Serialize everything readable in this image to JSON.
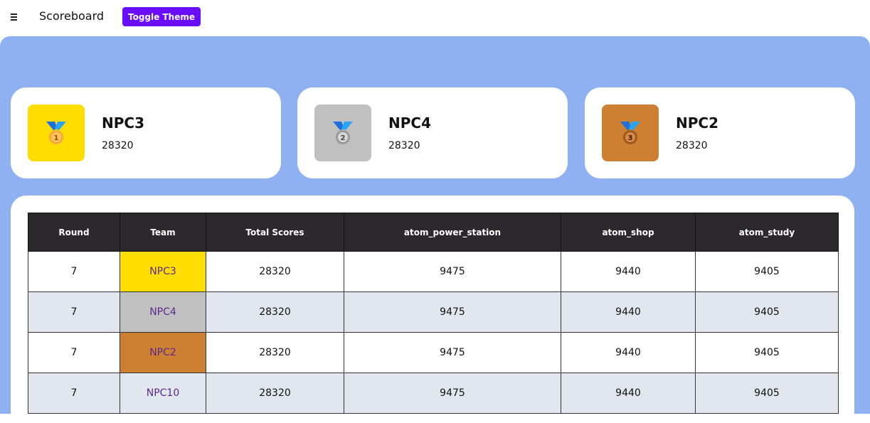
{
  "topbar": {
    "menu_icon": "hamburger-menu-icon",
    "title": "Scoreboard",
    "toggle_theme_label": "Toggle Theme"
  },
  "colors": {
    "accent": "#6a0dff",
    "background": "#8fb1f2",
    "gold": "#ffdd00",
    "silver": "#c0c0c0",
    "bronze": "#cd7f32",
    "header_bg": "#2d282c"
  },
  "podium": [
    {
      "rank": "1",
      "icon": "gold-medal-icon",
      "team": "NPC3",
      "score": "28320"
    },
    {
      "rank": "2",
      "icon": "silver-medal-icon",
      "team": "NPC4",
      "score": "28320"
    },
    {
      "rank": "3",
      "icon": "bronze-medal-icon",
      "team": "NPC2",
      "score": "28320"
    }
  ],
  "table": {
    "headers": [
      "Round",
      "Team",
      "Total Scores",
      "atom_power_station",
      "atom_shop",
      "atom_study"
    ],
    "rows": [
      [
        "7",
        "NPC3",
        "28320",
        "9475",
        "9440",
        "9405"
      ],
      [
        "7",
        "NPC4",
        "28320",
        "9475",
        "9440",
        "9405"
      ],
      [
        "7",
        "NPC2",
        "28320",
        "9475",
        "9440",
        "9405"
      ],
      [
        "7",
        "NPC10",
        "28320",
        "9475",
        "9440",
        "9405"
      ]
    ]
  }
}
